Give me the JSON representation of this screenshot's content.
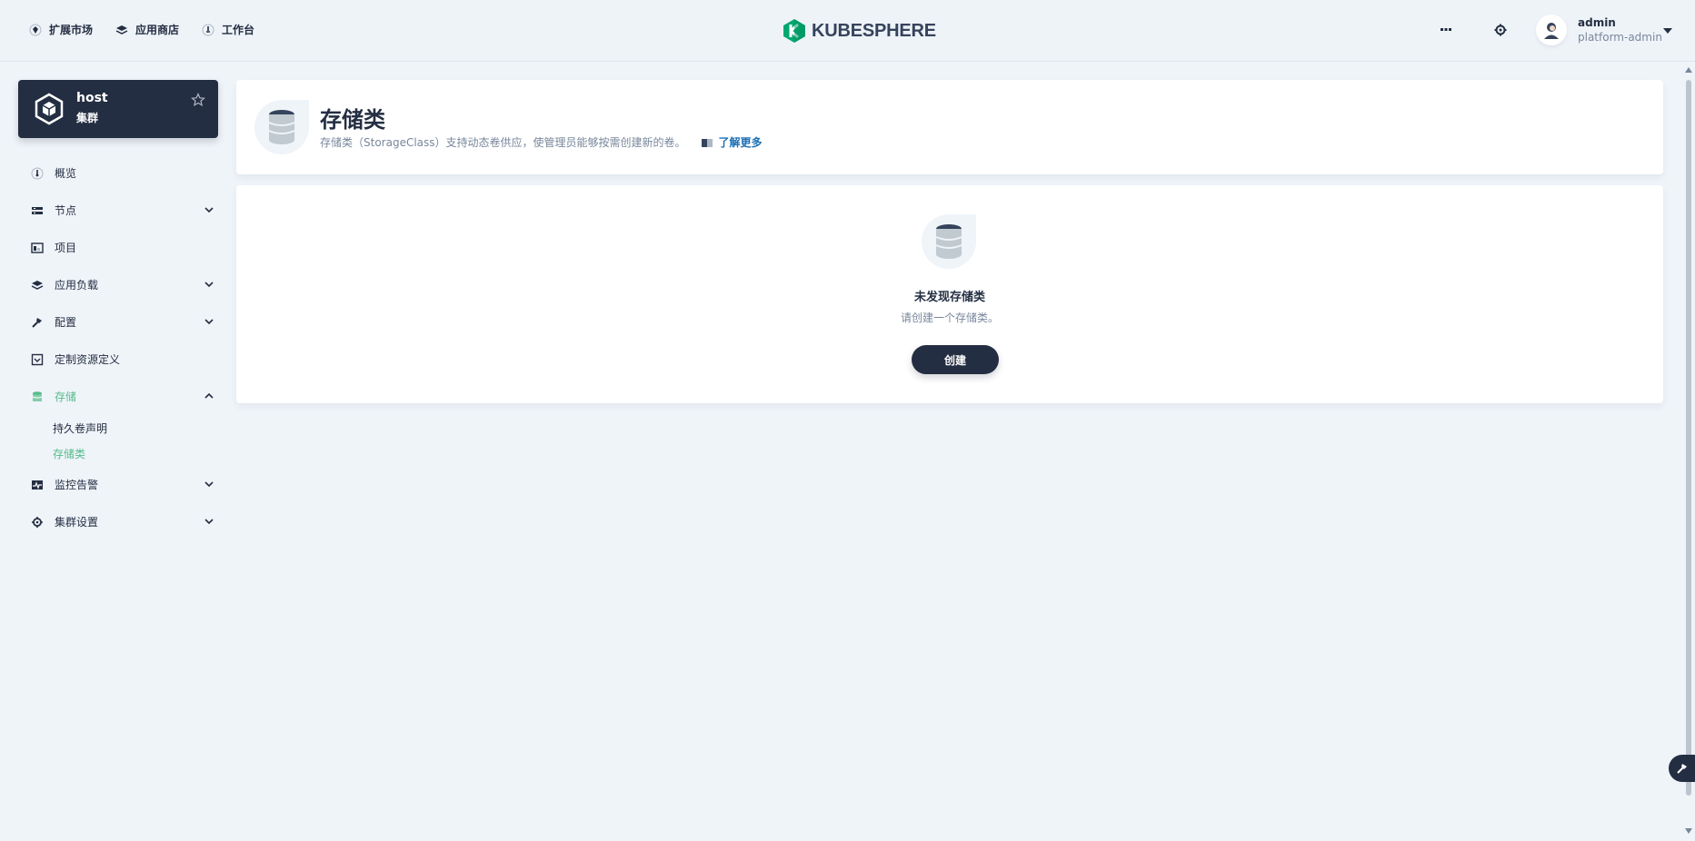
{
  "topnav": {
    "items": [
      {
        "label": "扩展市场",
        "icon": "extensions-icon"
      },
      {
        "label": "应用商店",
        "icon": "app-store-icon"
      },
      {
        "label": "工作台",
        "icon": "workbench-icon"
      }
    ],
    "logo_text": "KUBESPHERE",
    "user": {
      "name": "admin",
      "role": "platform-admin"
    }
  },
  "cluster": {
    "name": "host",
    "type": "集群"
  },
  "sidebar": {
    "items": [
      {
        "label": "概览",
        "icon": "overview-icon"
      },
      {
        "label": "节点",
        "icon": "nodes-icon",
        "expandable": true
      },
      {
        "label": "项目",
        "icon": "projects-icon"
      },
      {
        "label": "应用负载",
        "icon": "workloads-icon",
        "expandable": true
      },
      {
        "label": "配置",
        "icon": "configuration-icon",
        "expandable": true
      },
      {
        "label": "定制资源定义",
        "icon": "crd-icon"
      },
      {
        "label": "存储",
        "icon": "storage-icon",
        "expandable": true,
        "expanded": true,
        "active": true
      },
      {
        "label": "监控告警",
        "icon": "monitoring-icon",
        "expandable": true
      },
      {
        "label": "集群设置",
        "icon": "cluster-settings-icon",
        "expandable": true
      }
    ],
    "storage_sub": [
      {
        "label": "持久卷声明",
        "active": false
      },
      {
        "label": "存储类",
        "active": true
      }
    ]
  },
  "page": {
    "title": "存储类",
    "description": "存储类（StorageClass）支持动态卷供应，使管理员能够按需创建新的卷。",
    "learn_more": "了解更多"
  },
  "empty_state": {
    "title": "未发现存储类",
    "description": "请创建一个存储类。",
    "button": "创建"
  },
  "colors": {
    "accent": "#55bc8a",
    "dark": "#242e42",
    "link": "#1c6fb5",
    "background": "#eff4f9"
  }
}
